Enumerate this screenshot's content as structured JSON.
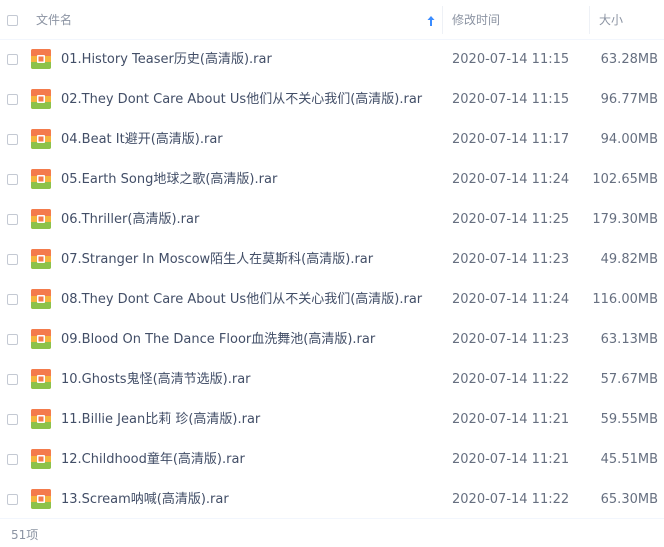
{
  "header": {
    "name_label": "文件名",
    "time_label": "修改时间",
    "size_label": "大小",
    "sort_icon": "sort-ascending-arrow-icon"
  },
  "colors": {
    "icon_orange": "#f47b4c",
    "icon_green": "#8cc24a",
    "icon_gold": "#f5b43d",
    "sort_blue": "#3b8cff"
  },
  "files": [
    {
      "name": "01.History Teaser历史(高清版).rar",
      "time": "2020-07-14 11:15",
      "size": "63.28MB"
    },
    {
      "name": "02.They Dont Care About Us他们从不关心我们(高清版).rar",
      "time": "2020-07-14 11:15",
      "size": "96.77MB"
    },
    {
      "name": "04.Beat It避开(高清版).rar",
      "time": "2020-07-14 11:17",
      "size": "94.00MB"
    },
    {
      "name": "05.Earth Song地球之歌(高清版).rar",
      "time": "2020-07-14 11:24",
      "size": "102.65MB"
    },
    {
      "name": "06.Thriller(高清版).rar",
      "time": "2020-07-14 11:25",
      "size": "179.30MB"
    },
    {
      "name": "07.Stranger In Moscow陌生人在莫斯科(高清版).rar",
      "time": "2020-07-14 11:23",
      "size": "49.82MB"
    },
    {
      "name": "08.They Dont Care About Us他们从不关心我们(高清版).rar",
      "time": "2020-07-14 11:24",
      "size": "116.00MB"
    },
    {
      "name": "09.Blood On The Dance Floor血洗舞池(高清版).rar",
      "time": "2020-07-14 11:23",
      "size": "63.13MB"
    },
    {
      "name": "10.Ghosts鬼怪(高清节选版).rar",
      "time": "2020-07-14 11:22",
      "size": "57.67MB"
    },
    {
      "name": "11.Billie Jean比莉 珍(高清版).rar",
      "time": "2020-07-14 11:21",
      "size": "59.55MB"
    },
    {
      "name": "12.Childhood童年(高清版).rar",
      "time": "2020-07-14 11:21",
      "size": "45.51MB"
    },
    {
      "name": "13.Scream呐喊(高清版).rar",
      "time": "2020-07-14 11:22",
      "size": "65.30MB"
    }
  ],
  "footer": {
    "count": "51项"
  }
}
